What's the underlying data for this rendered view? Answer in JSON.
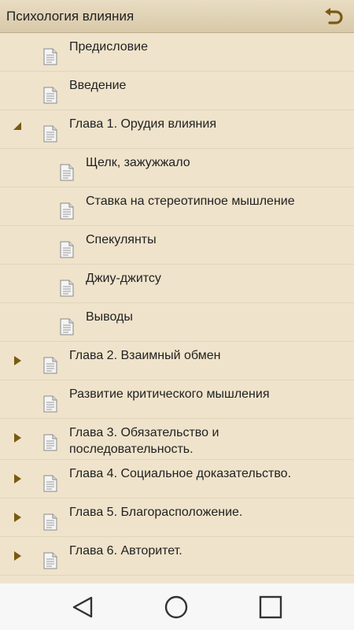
{
  "header": {
    "title": "Психология влияния",
    "back_icon": "back-arrow-icon",
    "accent": "#7a5a12"
  },
  "items": [
    {
      "label": "Предисловие",
      "level": 0,
      "expander": "none"
    },
    {
      "label": "Введение",
      "level": 0,
      "expander": "none"
    },
    {
      "label": "Глава 1. Орудия влияния",
      "level": 0,
      "expander": "expanded"
    },
    {
      "label": "Щелк, зажужжало",
      "level": 1,
      "expander": "none"
    },
    {
      "label": "Ставка на стереотипное мышление",
      "level": 1,
      "expander": "none"
    },
    {
      "label": "Спекулянты",
      "level": 1,
      "expander": "none"
    },
    {
      "label": "Джиу-джитсу",
      "level": 1,
      "expander": "none"
    },
    {
      "label": "Выводы",
      "level": 1,
      "expander": "none"
    },
    {
      "label": "Глава 2. Взаимный обмен",
      "level": 0,
      "expander": "collapsed"
    },
    {
      "label": "Развитие критического мышления",
      "level": 0,
      "expander": "none"
    },
    {
      "label": "Глава 3. Обязательство и последовательность.",
      "level": 0,
      "expander": "collapsed"
    },
    {
      "label": "Глава 4. Социальное доказательство.",
      "level": 0,
      "expander": "collapsed"
    },
    {
      "label": "Глава 5. Благорасположение.",
      "level": 0,
      "expander": "collapsed"
    },
    {
      "label": "Глава 6. Авторитет.",
      "level": 0,
      "expander": "collapsed"
    }
  ],
  "navbar": {
    "back_icon": "nav-back-icon",
    "home_icon": "nav-home-icon",
    "recents_icon": "nav-recents-icon"
  }
}
